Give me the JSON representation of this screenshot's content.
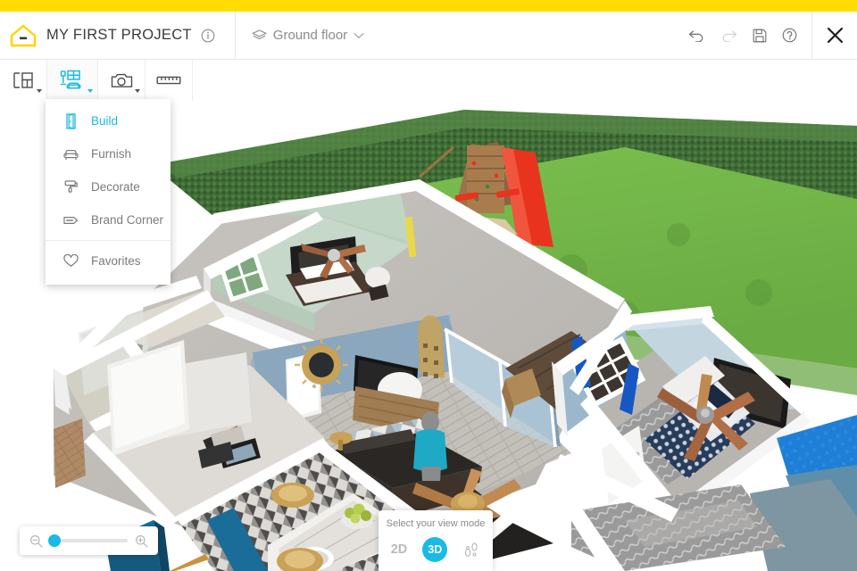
{
  "app": {
    "brand_yellow": "#ffdd00",
    "accent_cyan": "#19b9e8",
    "logo_icon": "house-logo-icon"
  },
  "header": {
    "title": "MY FIRST PROJECT",
    "info_icon": "info-circle-icon",
    "floor": {
      "icon": "layers-icon",
      "label": "Ground floor",
      "chevron": "chevron-down-icon"
    },
    "actions": [
      {
        "name": "undo-button",
        "icon": "undo-arrow-icon",
        "enabled": true
      },
      {
        "name": "redo-button",
        "icon": "redo-arrow-icon",
        "enabled": false
      },
      {
        "name": "save-button",
        "icon": "floppy-disk-icon",
        "enabled": true
      },
      {
        "name": "help-button",
        "icon": "question-circle-icon",
        "enabled": true
      }
    ],
    "close_icon": "close-x-icon"
  },
  "toolbar": {
    "buttons": [
      {
        "name": "floorplan-tool",
        "icon": "floorplan-icon",
        "active": false,
        "has_caret": true
      },
      {
        "name": "furnish-tool",
        "icon": "furniture-icon",
        "active": true,
        "has_caret": true
      },
      {
        "name": "camera-tool",
        "icon": "camera-icon",
        "active": false,
        "has_caret": true
      },
      {
        "name": "measure-tool",
        "icon": "ruler-icon",
        "active": false,
        "has_caret": false
      }
    ]
  },
  "menu": {
    "items": [
      {
        "label": "Build",
        "icon": "door-icon",
        "selected": true
      },
      {
        "label": "Furnish",
        "icon": "armchair-icon",
        "selected": false
      },
      {
        "label": "Decorate",
        "icon": "paint-roller-icon",
        "selected": false
      },
      {
        "label": "Brand Corner",
        "icon": "tag-icon",
        "selected": false
      },
      {
        "label": "Favorites",
        "icon": "heart-icon",
        "selected": false
      }
    ],
    "divider_before_index": 4
  },
  "zoom_control": {
    "zoom_out_icon": "magnifier-minus-icon",
    "zoom_in_icon": "magnifier-plus-icon",
    "value_percent": 6
  },
  "view_mode": {
    "title": "Select your view mode",
    "options": [
      {
        "label": "2D",
        "name": "view-mode-2d",
        "active": false
      },
      {
        "label": "3D",
        "name": "view-mode-3d",
        "active": true
      },
      {
        "label": "",
        "name": "view-mode-walkthrough",
        "icon": "footsteps-icon",
        "active": false
      }
    ]
  },
  "scene": {
    "description": "Isometric 3D cutaway render of a single-storey house floor plan with backyard",
    "rooms": [
      {
        "name": "bedroom-green",
        "wall_color": "#b9cfbe"
      },
      {
        "name": "living-room",
        "wall_color": "#8aa7bd"
      },
      {
        "name": "bedroom-blue",
        "wall_color": "#9bb7cb"
      },
      {
        "name": "kitchen",
        "wall_color": "#e6e6e6"
      },
      {
        "name": "bathroom",
        "wall_color": "#d9dad2"
      }
    ],
    "outdoor": {
      "lawn_color": "#72b847",
      "hedge_color": "#3f6b36",
      "playset": "wooden-playset-with-red-slide",
      "slide_color": "#e8341f"
    },
    "character": {
      "name": "avatar-person",
      "shirt_color": "#1eaac4"
    }
  }
}
